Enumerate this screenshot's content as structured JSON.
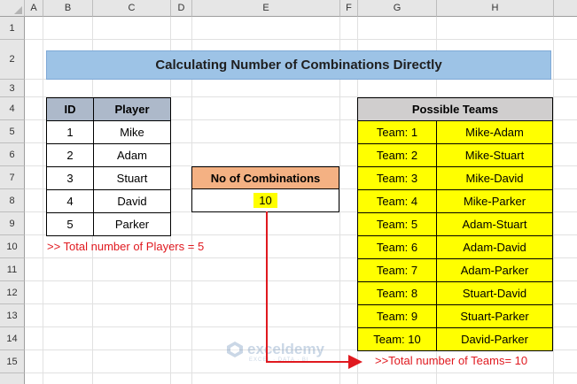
{
  "columns": [
    "A",
    "B",
    "C",
    "D",
    "E",
    "F",
    "G",
    "H"
  ],
  "rows": [
    "1",
    "2",
    "3",
    "4",
    "5",
    "6",
    "7",
    "8",
    "9",
    "10",
    "11",
    "12",
    "13",
    "14",
    "15"
  ],
  "title": "Calculating Number of Combinations Directly",
  "players": {
    "headers": [
      "ID",
      "Player"
    ],
    "rows": [
      [
        "1",
        "Mike"
      ],
      [
        "2",
        "Adam"
      ],
      [
        "3",
        "Stuart"
      ],
      [
        "4",
        "David"
      ],
      [
        "5",
        "Parker"
      ]
    ]
  },
  "combinations": {
    "label": "No of Combinations",
    "value": "10"
  },
  "teams": {
    "header": "Possible Teams",
    "rows": [
      [
        "Team: 1",
        "Mike-Adam"
      ],
      [
        "Team: 2",
        "Mike-Stuart"
      ],
      [
        "Team: 3",
        "Mike-David"
      ],
      [
        "Team: 4",
        "Mike-Parker"
      ],
      [
        "Team: 5",
        "Adam-Stuart"
      ],
      [
        "Team: 6",
        "Adam-David"
      ],
      [
        "Team: 7",
        "Adam-Parker"
      ],
      [
        "Team: 8",
        "Stuart-David"
      ],
      [
        "Team: 9",
        "Stuart-Parker"
      ],
      [
        "Team: 10",
        "David-Parker"
      ]
    ]
  },
  "notes": {
    "players_total": ">> Total number of Players = 5",
    "teams_total": ">>Total number of Teams= 10"
  },
  "watermark": {
    "name": "exceldemy",
    "tagline": "EXCEL · DATA · BI"
  },
  "colors": {
    "title_bg": "#9dc3e6",
    "player_header_bg": "#adb9ca",
    "combo_header_bg": "#f4b183",
    "teams_header_bg": "#d0cece",
    "highlight": "#ffff00",
    "note_red": "#e0191f"
  }
}
